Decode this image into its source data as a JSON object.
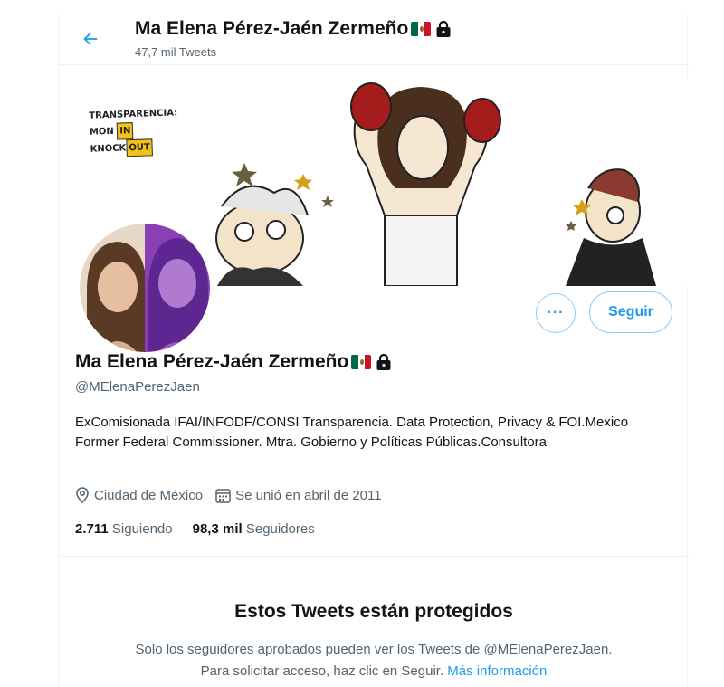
{
  "header": {
    "name": "Ma Elena Pérez-Jaén Zermeño",
    "tweet_count": "47,7 mil Tweets"
  },
  "banner": {
    "caption_line1": "TRANSPARENCIA:",
    "caption_line2_a": "MON",
    "caption_line2_b": "IN",
    "caption_line3_a": "KNOCK",
    "caption_line3_b": "OUT"
  },
  "actions": {
    "more_label": "···",
    "follow_label": "Seguir"
  },
  "profile": {
    "name": "Ma Elena Pérez-Jaén Zermeño",
    "handle": "@MElenaPerezJaen",
    "bio": "ExComisionada IFAI/INFODF/CONSI Transparencia. Data Protection, Privacy & FOI.Mexico Former Federal Commissioner. Mtra. Gobierno y Políticas Públicas.Consultora",
    "location": "Ciudad de México",
    "joined": "Se unió en abril de 2011",
    "following_count": "2.711",
    "following_label": "Siguiendo",
    "followers_count": "98,3 mil",
    "followers_label": "Seguidores"
  },
  "protected": {
    "title": "Estos Tweets están protegidos",
    "line1": "Solo los seguidores aprobados pueden ver los Tweets de @MElenaPerezJaen.",
    "line2": "Para solicitar acceso, haz clic en Seguir.",
    "link": "Más información"
  },
  "colors": {
    "accent": "#1d9bf0",
    "muted_text": "#536471",
    "border": "#eff3f4"
  },
  "icons": [
    "back-arrow-icon",
    "mexico-flag-icon",
    "lock-icon",
    "location-icon",
    "calendar-icon",
    "more-icon"
  ]
}
